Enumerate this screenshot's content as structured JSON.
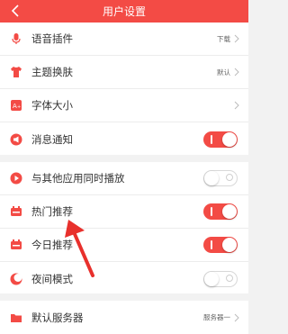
{
  "header": {
    "title": "用户设置"
  },
  "group1": {
    "items": [
      {
        "label": "语音插件",
        "value": "下载"
      },
      {
        "label": "主题换肤",
        "value": "默认"
      },
      {
        "label": "字体大小",
        "value": ""
      },
      {
        "label": "消息通知",
        "toggle": "on"
      }
    ]
  },
  "group2": {
    "items": [
      {
        "label": "与其他应用同时播放",
        "toggle": "off"
      },
      {
        "label": "热门推荐",
        "toggle": "on"
      },
      {
        "label": "今日推荐",
        "toggle": "on"
      },
      {
        "label": "夜间模式",
        "toggle": "off"
      }
    ]
  },
  "group3": {
    "items": [
      {
        "label": "默认服务器",
        "value": "服务器一"
      }
    ]
  },
  "colors": {
    "accent": "#f34b45",
    "background": "#f2f2f2",
    "arrow": "#e8302c"
  }
}
